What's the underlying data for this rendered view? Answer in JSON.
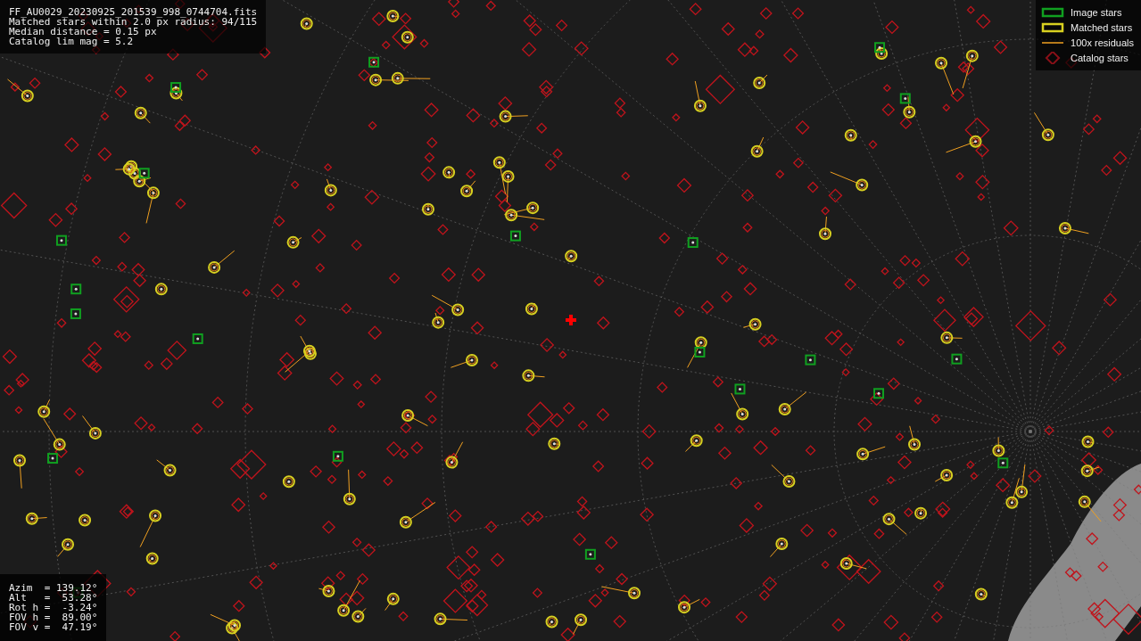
{
  "info_box": {
    "lines": [
      "FF_AU0029_20230925_201539_998_0744704.fits",
      "Matched stars within 2.0 px radius: 94/115",
      "Median distance = 0.15 px",
      "Catalog lim mag = 5.2"
    ]
  },
  "legend": [
    {
      "kind": "image",
      "label": "Image stars"
    },
    {
      "kind": "matched",
      "label": "Matched stars"
    },
    {
      "kind": "residual",
      "label": "100x residuals"
    },
    {
      "kind": "catalog",
      "label": "Catalog stars"
    }
  ],
  "pointing_box": {
    "lines": [
      "Azim  = 139.12°",
      "Alt   =  53.28°",
      "Rot h =  -3.24°",
      "FOV h =  89.00°",
      "FOV v =  47.19°"
    ]
  }
}
